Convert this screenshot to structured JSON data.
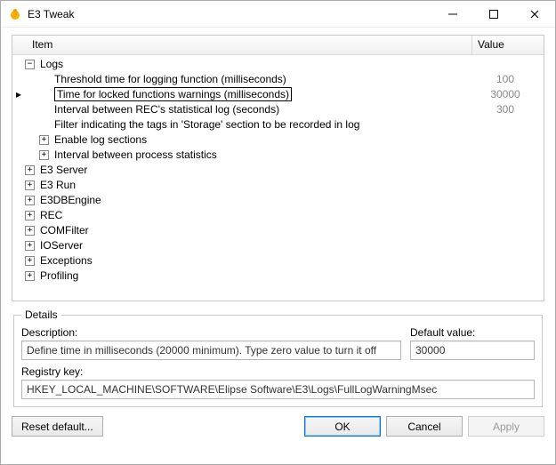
{
  "window": {
    "title": "E3 Tweak"
  },
  "columns": {
    "item": "Item",
    "value": "Value"
  },
  "tree": [
    {
      "depth": 0,
      "exp": "minus",
      "label": "Logs",
      "value": "",
      "selected": false
    },
    {
      "depth": 1,
      "exp": "none",
      "label": "Threshold time for logging function (milliseconds)",
      "value": "100",
      "selected": false
    },
    {
      "depth": 1,
      "exp": "none",
      "label": "Time for locked functions warnings (milliseconds)",
      "value": "30000",
      "selected": true
    },
    {
      "depth": 1,
      "exp": "none",
      "label": "Interval between REC's statistical log (seconds)",
      "value": "300",
      "selected": false
    },
    {
      "depth": 1,
      "exp": "none",
      "label": "Filter indicating the tags in 'Storage' section to be recorded in log",
      "value": "",
      "selected": false
    },
    {
      "depth": 1,
      "exp": "plus",
      "label": "Enable log sections",
      "value": "",
      "selected": false
    },
    {
      "depth": 1,
      "exp": "plus",
      "label": "Interval between process statistics",
      "value": "",
      "selected": false
    },
    {
      "depth": 0,
      "exp": "plus",
      "label": "E3 Server",
      "value": "",
      "selected": false
    },
    {
      "depth": 0,
      "exp": "plus",
      "label": "E3 Run",
      "value": "",
      "selected": false
    },
    {
      "depth": 0,
      "exp": "plus",
      "label": "E3DBEngine",
      "value": "",
      "selected": false
    },
    {
      "depth": 0,
      "exp": "plus",
      "label": "REC",
      "value": "",
      "selected": false
    },
    {
      "depth": 0,
      "exp": "plus",
      "label": "COMFilter",
      "value": "",
      "selected": false
    },
    {
      "depth": 0,
      "exp": "plus",
      "label": "IOServer",
      "value": "",
      "selected": false
    },
    {
      "depth": 0,
      "exp": "plus",
      "label": "Exceptions",
      "value": "",
      "selected": false
    },
    {
      "depth": 0,
      "exp": "plus",
      "label": "Profiling",
      "value": "",
      "selected": false
    }
  ],
  "details": {
    "legend": "Details",
    "description_label": "Description:",
    "description_value": "Define time in milliseconds (20000 minimum). Type zero value to turn it off",
    "default_label": "Default value:",
    "default_value": "30000",
    "registry_label": "Registry key:",
    "registry_value": "HKEY_LOCAL_MACHINE\\SOFTWARE\\Elipse Software\\E3\\Logs\\FullLogWarningMsec"
  },
  "buttons": {
    "reset": "Reset default...",
    "ok": "OK",
    "cancel": "Cancel",
    "apply": "Apply"
  }
}
